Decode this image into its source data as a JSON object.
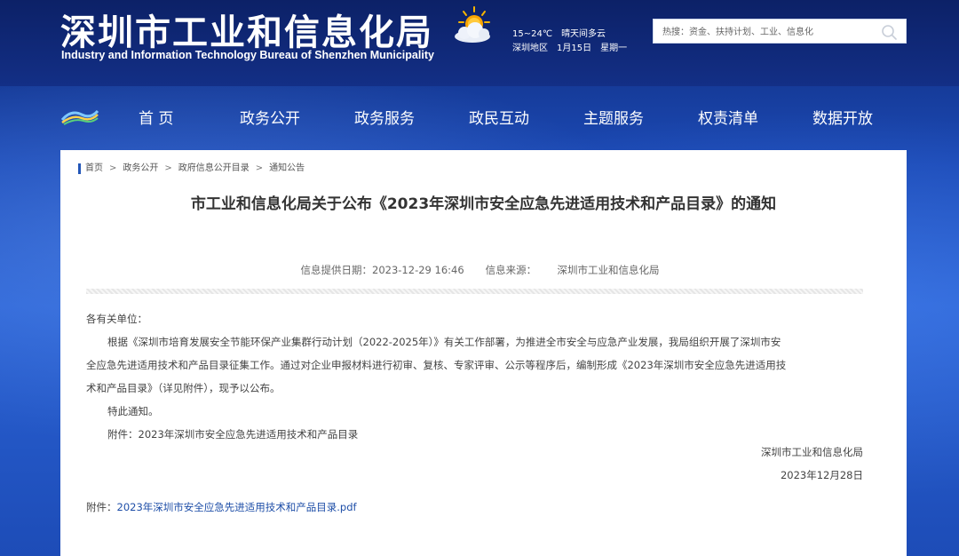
{
  "header": {
    "title": "深圳市工业和信息化局",
    "subtitle": "Industry and Information Technology Bureau of Shenzhen Municipality",
    "weather": {
      "temp": "15~24℃",
      "desc": "晴天间多云",
      "area": "深圳地区",
      "date": "1月15日",
      "weekday": "星期一"
    },
    "search": {
      "placeholder": "热搜：资金、扶持计划、工业、信息化"
    }
  },
  "nav": {
    "items": [
      {
        "label": "首 页"
      },
      {
        "label": "政务公开"
      },
      {
        "label": "政务服务"
      },
      {
        "label": "政民互动"
      },
      {
        "label": "主题服务"
      },
      {
        "label": "权责清单"
      },
      {
        "label": "数据开放"
      }
    ]
  },
  "breadcrumb": [
    {
      "label": "首页"
    },
    {
      "label": "政务公开"
    },
    {
      "label": "政府信息公开目录"
    },
    {
      "label": "通知公告"
    }
  ],
  "breadcrumb_sep": ">",
  "article": {
    "title": "市工业和信息化局关于公布《2023年深圳市安全应急先进适用技术和产品目录》的通知",
    "date_label": "信息提供日期：2023-12-29 16:46",
    "source_label": "信息来源：",
    "source": "深圳市工业和信息化局",
    "greeting": "各有关单位：",
    "para1_l1": "根据《深圳市培育发展安全节能环保产业集群行动计划（2022-2025年）》有关工作部署，为推进全市安全与应急产业发展，我局组织开展了深圳市安",
    "para1_l2": "全应急先进适用技术和产品目录征集工作。通过对企业申报材料进行初审、复核、专家评审、公示等程序后，编制形成《2023年深圳市安全应急先进适用技",
    "para1_l3": "术和产品目录》（详见附件），现予以公布。",
    "para2": "特此通知。",
    "para3": "附件：2023年深圳市安全应急先进适用技术和产品目录",
    "sign_org": "深圳市工业和信息化局",
    "sign_date": "2023年12月28日",
    "attachment_label": "附件：",
    "attachment_link": "2023年深圳市安全应急先进适用技术和产品目录.pdf"
  },
  "colors": {
    "header_bg": "#0c2167",
    "nav_bg": "#1c4bb8",
    "link": "#1f4fa8",
    "breadcrumb_accent": "#2356b8"
  }
}
